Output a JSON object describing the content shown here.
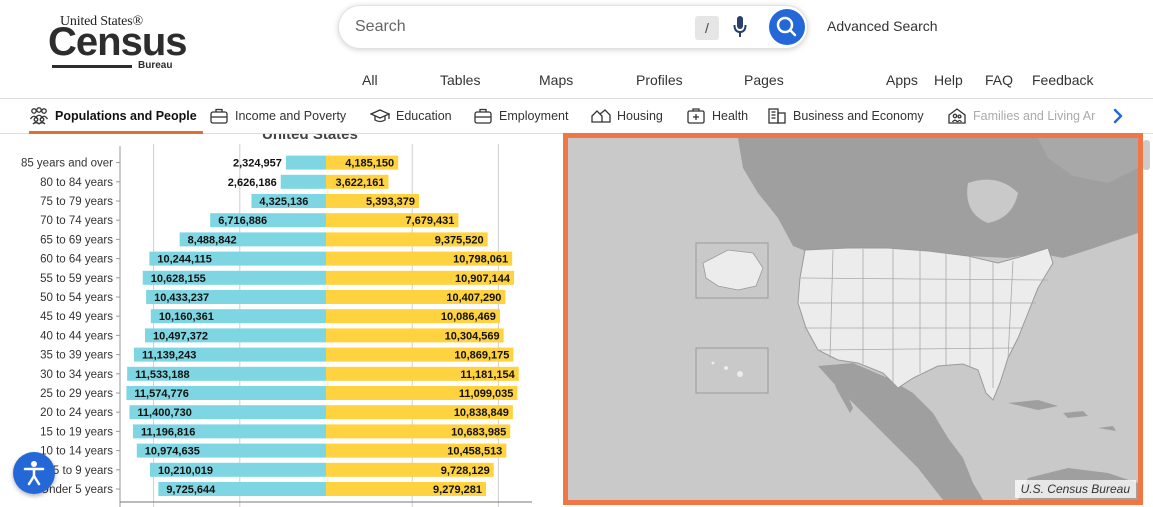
{
  "header": {
    "logo_top": "United States®",
    "logo_main": "Census",
    "logo_bottom": "Bureau",
    "search_placeholder": "Search",
    "search_shortcut": "/",
    "advanced_search": "Advanced Search",
    "subnav": [
      "All",
      "Tables",
      "Maps",
      "Profiles",
      "Pages",
      "Apps",
      "Help",
      "FAQ",
      "Feedback"
    ]
  },
  "categories": [
    {
      "label": "Populations and People",
      "icon": "people-icon"
    },
    {
      "label": "Income and Poverty",
      "icon": "briefcase-icon"
    },
    {
      "label": "Education",
      "icon": "graduation-cap-icon"
    },
    {
      "label": "Employment",
      "icon": "briefcase-icon"
    },
    {
      "label": "Housing",
      "icon": "houses-icon"
    },
    {
      "label": "Health",
      "icon": "medical-kit-icon"
    },
    {
      "label": "Business and Economy",
      "icon": "building-icon"
    },
    {
      "label": "Families and Living Ar",
      "icon": "family-icon"
    }
  ],
  "chart_data": {
    "type": "bar",
    "title": "United States",
    "categories": [
      "85 years and over",
      "80 to 84 years",
      "75 to 79 years",
      "70 to 74 years",
      "65 to 69 years",
      "60 to 64 years",
      "55 to 59 years",
      "50 to 54 years",
      "45 to 49 years",
      "40 to 44 years",
      "35 to 39 years",
      "30 to 34 years",
      "25 to 29 years",
      "20 to 24 years",
      "15 to 19 years",
      "10 to 14 years",
      "5 to 9 years",
      "Under 5 years"
    ],
    "series": [
      {
        "color": "#7fd6e3",
        "values": [
          2324957,
          2626186,
          4325136,
          6716886,
          8488842,
          10244115,
          10628155,
          10433237,
          10160361,
          10497372,
          11139243,
          11533188,
          11574776,
          11400730,
          11196816,
          10974635,
          10210019,
          9725644
        ]
      },
      {
        "color": "#ffd23f",
        "values": [
          4185150,
          3622161,
          5393379,
          7679431,
          9375520,
          10798061,
          10907144,
          10407290,
          10086469,
          10304569,
          10869175,
          11181154,
          11099035,
          10838849,
          10683985,
          10458513,
          9728129,
          9279281
        ]
      }
    ],
    "value_labels_left": [
      "2,324,957",
      "2,626,186",
      "4,325,136",
      "6,716,886",
      "8,488,842",
      "10,244,115",
      "10,628,155",
      "10,433,237",
      "10,160,361",
      "10,497,372",
      "11,139,243",
      "11,533,188",
      "11,574,776",
      "11,400,730",
      "11,196,816",
      "10,974,635",
      "10,210,019",
      "9,725,644"
    ],
    "value_labels_right": [
      "4,185,150",
      "3,622,161",
      "5,393,379",
      "7,679,431",
      "9,375,520",
      "10,798,061",
      "10,907,144",
      "10,407,290",
      "10,086,469",
      "10,304,569",
      "10,869,175",
      "11,181,154",
      "11,099,035",
      "10,838,849",
      "10,683,985",
      "10,458,513",
      "9,728,129",
      "9,279,281"
    ],
    "xlim": [
      -14000000,
      14000000
    ],
    "grid": true
  },
  "map": {
    "credit": "U.S. Census Bureau",
    "water_color": "#c9c9c9",
    "land_color": "#9f9f9f",
    "us_color": "#ececec"
  },
  "colors": {
    "accent": "#f07645",
    "search_button": "#2468d8"
  }
}
